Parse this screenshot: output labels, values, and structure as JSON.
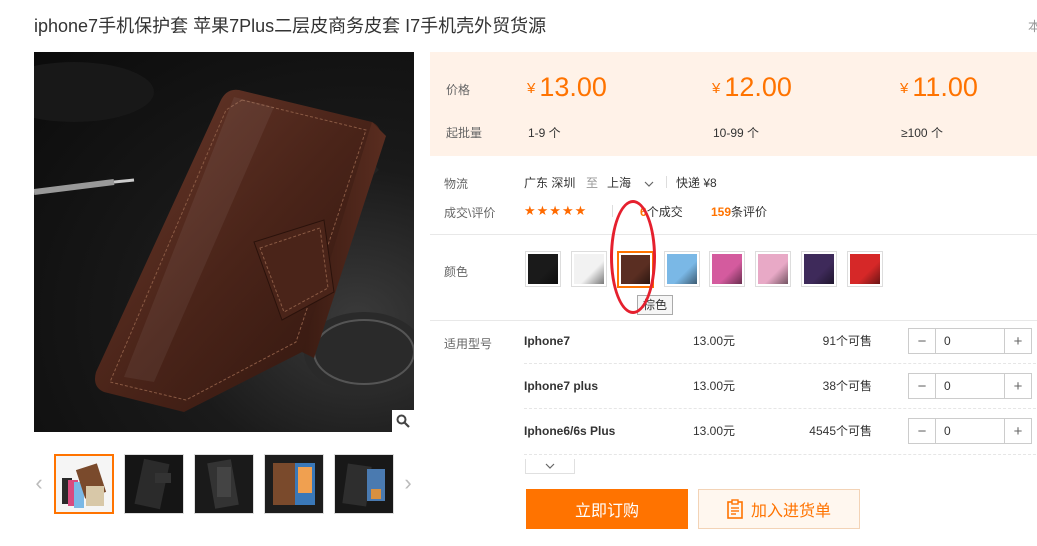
{
  "product": {
    "title": "iphone7手机保护套 苹果7Plus二层皮商务皮套 I7手机壳外贸货源",
    "title_right_fragment": "本"
  },
  "pricing": {
    "price_label": "价格",
    "batch_label": "起批量",
    "tiers": [
      {
        "currency": "¥",
        "price": "13.00",
        "range": "1-9 个"
      },
      {
        "currency": "¥",
        "price": "12.00",
        "range": "10-99 个"
      },
      {
        "currency": "¥",
        "price": "11.00",
        "range": "≥100 个"
      }
    ]
  },
  "logistics": {
    "label": "物流",
    "from": "广东 深圳",
    "to_word": "至",
    "destination": "上海",
    "shipping": "快递 ¥8"
  },
  "deals": {
    "label": "成交\\评价",
    "deals_count_partial": "6",
    "deals_suffix": "个成交",
    "reviews_count": "159",
    "reviews_suffix": "条评价"
  },
  "color": {
    "label": "颜色",
    "swatches": [
      "#1a1a1a",
      "#f2f2f2",
      "#5a2e22",
      "#7ab8e6",
      "#d45b9e",
      "#e8a9c6",
      "#3e2a5a",
      "#d62828"
    ],
    "tooltip": "棕色"
  },
  "models": {
    "label": "适用型号",
    "rows": [
      {
        "name": "Iphone7",
        "price": "13.00元",
        "stock": "91个可售",
        "qty": "0"
      },
      {
        "name": "Iphone7 plus",
        "price": "13.00元",
        "stock": "38个可售",
        "qty": "0"
      },
      {
        "name": "Iphone6/6s Plus",
        "price": "13.00元",
        "stock": "4545个可售",
        "qty": "0"
      }
    ]
  },
  "actions": {
    "buy_now": "立即订购",
    "add_to_cart": "加入进货单"
  },
  "colors": {
    "accent": "#ff7300",
    "price_bg": "#fff2e8",
    "annotation": "#e5202e"
  }
}
